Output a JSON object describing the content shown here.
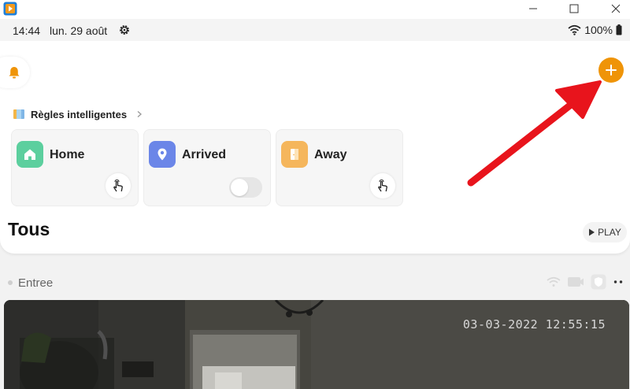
{
  "status_bar": {
    "time": "14:44",
    "date": "lun. 29 août",
    "battery": "100%"
  },
  "smart_rules": {
    "title": "Règles intelligentes",
    "cards": [
      {
        "label": "Home",
        "icon": "home-icon",
        "color": "#5ccf9e",
        "control": "tap"
      },
      {
        "label": "Arrived",
        "icon": "location-pin-icon",
        "color": "#6b86e8",
        "control": "toggle",
        "enabled": false
      },
      {
        "label": "Away",
        "icon": "door-icon",
        "color": "#f5b65c",
        "control": "tap"
      }
    ]
  },
  "devices": {
    "section_title": "Tous",
    "play_label": "PLAY"
  },
  "camera": {
    "name": "Entree",
    "timestamp": "03-03-2022 12:55:15"
  },
  "colors": {
    "accent": "#ef9408",
    "annotation_arrow": "#e8141c"
  }
}
